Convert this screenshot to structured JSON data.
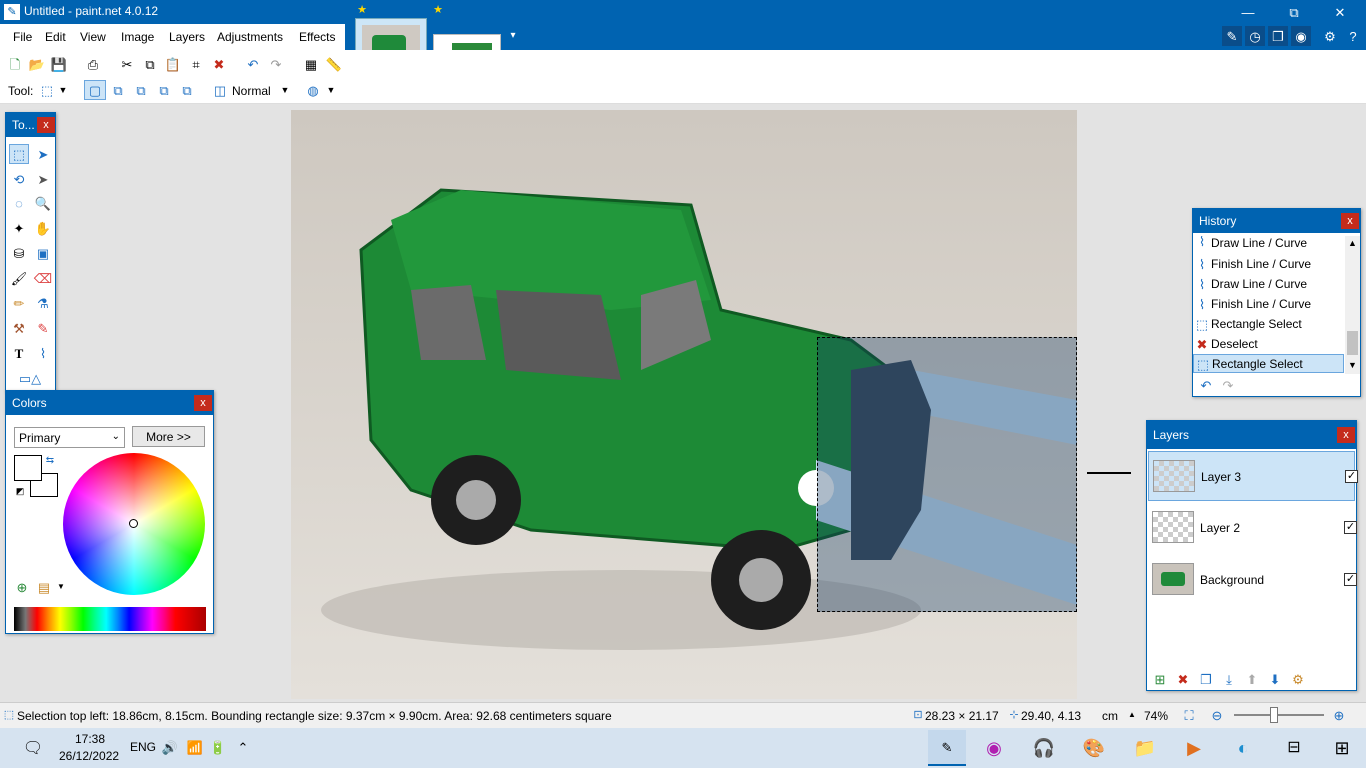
{
  "app": {
    "title": "Untitled - paint.net 4.0.12"
  },
  "window_controls": {
    "minimize": "—",
    "maximize": "⧉",
    "close": "✕"
  },
  "menu": {
    "items": [
      "File",
      "Edit",
      "View",
      "Image",
      "Layers",
      "Adjustments",
      "Effects"
    ]
  },
  "toolbar2": {
    "tool_label": "Tool:",
    "blend_mode": "Normal"
  },
  "tools_panel": {
    "title": "To...",
    "close": "x"
  },
  "colors_panel": {
    "title": "Colors",
    "close": "x",
    "mode": "Primary",
    "more_button": "More >>"
  },
  "history_panel": {
    "title": "History",
    "close": "x",
    "items": [
      "Draw Line / Curve",
      "Finish Line / Curve",
      "Draw Line / Curve",
      "Finish Line / Curve",
      "Rectangle Select",
      "Deselect",
      "Rectangle Select"
    ],
    "selected_index": 6
  },
  "layers_panel": {
    "title": "Layers",
    "close": "x",
    "layers": [
      {
        "name": "Layer 3",
        "visible": true,
        "selected": true
      },
      {
        "name": "Layer 2",
        "visible": true,
        "selected": false
      },
      {
        "name": "Background",
        "visible": true,
        "selected": false
      }
    ]
  },
  "status": {
    "selection_info": "Selection top left: 18.86cm, 8.15cm. Bounding rectangle size: 9.37cm × 9.90cm. Area: 92.68 centimeters square",
    "size": "28.23 × 21.17",
    "cursor": "29.40, 4.13",
    "units": "cm",
    "zoom": "74%"
  },
  "taskbar": {
    "time": "17:38",
    "date": "26/12/2022",
    "language": "ENG"
  },
  "colors": {
    "accent": "#0063b1",
    "selection_highlight": "#cce4f7",
    "close_red": "#c42b1c",
    "car_green": "#1f8a3a"
  }
}
